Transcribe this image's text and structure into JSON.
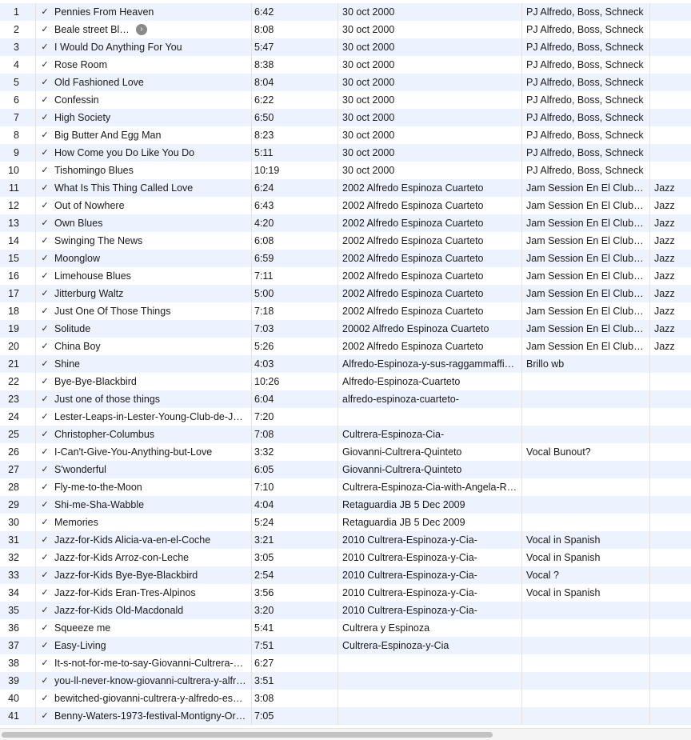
{
  "columns": {
    "check_glyph": "✓",
    "arrow_icon": "chevron-right-circle-icon"
  },
  "tracks": [
    {
      "num": "1",
      "name": "Pennies From Heaven",
      "time": "6:42",
      "album": "30 oct 2000",
      "artist": "PJ Alfredo, Boss, Schneck",
      "genre": ""
    },
    {
      "num": "2",
      "name": "Beale street Blues",
      "time": "8:08",
      "album": "30 oct 2000",
      "artist": "PJ Alfredo, Boss, Schneck",
      "genre": ""
    },
    {
      "num": "3",
      "name": "I Would Do Anything For You",
      "time": "5:47",
      "album": "30 oct 2000",
      "artist": "PJ Alfredo, Boss, Schneck",
      "genre": ""
    },
    {
      "num": "4",
      "name": "Rose Room",
      "time": "8:38",
      "album": "30 oct 2000",
      "artist": "PJ Alfredo, Boss, Schneck",
      "genre": ""
    },
    {
      "num": "5",
      "name": "Old Fashioned Love",
      "time": "8:04",
      "album": "30 oct 2000",
      "artist": "PJ Alfredo, Boss, Schneck",
      "genre": ""
    },
    {
      "num": "6",
      "name": "Confessin",
      "time": "6:22",
      "album": "30 oct 2000",
      "artist": "PJ Alfredo, Boss, Schneck",
      "genre": ""
    },
    {
      "num": "7",
      "name": "High Society",
      "time": "6:50",
      "album": "30 oct 2000",
      "artist": "PJ Alfredo, Boss, Schneck",
      "genre": ""
    },
    {
      "num": "8",
      "name": "Big Butter And Egg Man",
      "time": "8:23",
      "album": "30 oct 2000",
      "artist": "PJ Alfredo, Boss, Schneck",
      "genre": ""
    },
    {
      "num": "9",
      "name": "How Come you Do Like You Do",
      "time": "5:11",
      "album": "30 oct 2000",
      "artist": "PJ Alfredo, Boss, Schneck",
      "genre": ""
    },
    {
      "num": "10",
      "name": "Tishomingo Blues",
      "time": "10:19",
      "album": "30 oct 2000",
      "artist": "PJ Alfredo, Boss, Schneck",
      "genre": ""
    },
    {
      "num": "11",
      "name": "What Is This Thing Called Love",
      "time": "6:24",
      "album": "2002 Alfredo Espinoza Cuarteto",
      "artist": "Jam Session En El Club…",
      "genre": "Jazz"
    },
    {
      "num": "12",
      "name": "Out of Nowhere",
      "time": "6:43",
      "album": "2002 Alfredo Espinoza Cuarteto",
      "artist": "Jam Session En El Club…",
      "genre": "Jazz"
    },
    {
      "num": "13",
      "name": "Own Blues",
      "time": "4:20",
      "album": "2002 Alfredo Espinoza Cuarteto",
      "artist": "Jam Session En El Club…",
      "genre": "Jazz"
    },
    {
      "num": "14",
      "name": "Swinging The News",
      "time": "6:08",
      "album": "2002 Alfredo Espinoza Cuarteto",
      "artist": "Jam Session En El Club…",
      "genre": "Jazz"
    },
    {
      "num": "15",
      "name": "Moonglow",
      "time": "6:59",
      "album": "2002 Alfredo Espinoza Cuarteto",
      "artist": "Jam Session En El Club…",
      "genre": "Jazz"
    },
    {
      "num": "16",
      "name": "Limehouse Blues",
      "time": "7:11",
      "album": "2002 Alfredo Espinoza Cuarteto",
      "artist": "Jam Session En El Club…",
      "genre": "Jazz"
    },
    {
      "num": "17",
      "name": "Jitterburg Waltz",
      "time": "5:00",
      "album": "2002 Alfredo Espinoza Cuarteto",
      "artist": "Jam Session En El Club…",
      "genre": "Jazz"
    },
    {
      "num": "18",
      "name": "Just One Of Those Things",
      "time": "7:18",
      "album": "2002 Alfredo Espinoza Cuarteto",
      "artist": "Jam Session En El Club…",
      "genre": "Jazz"
    },
    {
      "num": "19",
      "name": "Solitude",
      "time": "7:03",
      "album": "20002 Alfredo Espinoza Cuarteto",
      "artist": "Jam Session En El Club…",
      "genre": "Jazz"
    },
    {
      "num": "20",
      "name": "China Boy",
      "time": "5:26",
      "album": "2002 Alfredo Espinoza Cuarteto",
      "artist": "Jam Session En El Club…",
      "genre": "Jazz"
    },
    {
      "num": "21",
      "name": "Shine",
      "time": "4:03",
      "album": "Alfredo-Espinoza-y-sus-raggammaffiel…",
      "artist": "Brillo wb",
      "genre": ""
    },
    {
      "num": "22",
      "name": "Bye-Bye-Blackbird",
      "time": "10:26",
      "album": "Alfredo-Espinoza-Cuarteto",
      "artist": "",
      "genre": ""
    },
    {
      "num": "23",
      "name": "Just one of those things",
      "time": "6:04",
      "album": "alfredo-espinoza-cuarteto-",
      "artist": "",
      "genre": ""
    },
    {
      "num": "24",
      "name": "Lester-Leaps-in-Lester-Young-Club-de-Ja…",
      "time": "7:20",
      "album": "",
      "artist": "",
      "genre": ""
    },
    {
      "num": "25",
      "name": "Christopher-Columbus",
      "time": "7:08",
      "album": "Cultrera-Espinoza-Cia-",
      "artist": "",
      "genre": ""
    },
    {
      "num": "26",
      "name": "I-Can't-Give-You-Anything-but-Love",
      "time": "3:32",
      "album": "Giovanni-Cultrera-Quinteto",
      "artist": "Vocal Bunout?",
      "genre": ""
    },
    {
      "num": "27",
      "name": "S'wonderful",
      "time": "6:05",
      "album": "Giovanni-Cultrera-Quinteto",
      "artist": "",
      "genre": ""
    },
    {
      "num": "28",
      "name": "Fly-me-to-the-Moon",
      "time": "7:10",
      "album": "Cultrera-Espinoza-Cia-with-Angela-Ro…",
      "artist": "",
      "genre": ""
    },
    {
      "num": "29",
      "name": "Shi-me-Sha-Wabble",
      "time": "4:04",
      "album": "Retaguardia JB 5 Dec 2009",
      "artist": "",
      "genre": ""
    },
    {
      "num": "30",
      "name": "Memories",
      "time": "5:24",
      "album": "Retaguardia JB 5 Dec 2009",
      "artist": "",
      "genre": ""
    },
    {
      "num": "31",
      "name": "Jazz-for-Kids Alicia-va-en-el-Coche",
      "time": "3:21",
      "album": "2010 Cultrera-Espinoza-y-Cia-",
      "artist": "Vocal in Spanish",
      "genre": ""
    },
    {
      "num": "32",
      "name": "Jazz-for-Kids Arroz-con-Leche",
      "time": "3:05",
      "album": "2010 Cultrera-Espinoza-y-Cia-",
      "artist": "Vocal in Spanish",
      "genre": ""
    },
    {
      "num": "33",
      "name": "Jazz-for-Kids Bye-Bye-Blackbird",
      "time": "2:54",
      "album": "2010 Cultrera-Espinoza-y-Cia-",
      "artist": "Vocal ?",
      "genre": ""
    },
    {
      "num": "34",
      "name": "Jazz-for-Kids Eran-Tres-Alpinos",
      "time": "3:56",
      "album": "2010 Cultrera-Espinoza-y-Cia-",
      "artist": "Vocal in Spanish",
      "genre": ""
    },
    {
      "num": "35",
      "name": "Jazz-for-Kids Old-Macdonald",
      "time": "3:20",
      "album": "2010 Cultrera-Espinoza-y-Cia-",
      "artist": "",
      "genre": ""
    },
    {
      "num": "36",
      "name": "Squeeze me",
      "time": "5:41",
      "album": "Cultrera y Espinoza",
      "artist": "",
      "genre": ""
    },
    {
      "num": "37",
      "name": "Easy-Living",
      "time": "7:51",
      "album": "Cultrera-Espinoza-y-Cia",
      "artist": "",
      "genre": ""
    },
    {
      "num": "38",
      "name": "It-s-not-for-me-to-say-Giovanni-Cultrera-y…",
      "time": "6:27",
      "album": "",
      "artist": "",
      "genre": ""
    },
    {
      "num": "39",
      "name": "you-ll-never-know-giovanni-cultrera-y-alfr…",
      "time": "3:51",
      "album": "",
      "artist": "",
      "genre": ""
    },
    {
      "num": "40",
      "name": "bewitched-giovanni-cultrera-y-alfredo-esp…",
      "time": "3:08",
      "album": "",
      "artist": "",
      "genre": ""
    },
    {
      "num": "41",
      "name": "Benny-Waters-1973-festival-Montigny-Ori…",
      "time": "7:05",
      "album": "",
      "artist": "",
      "genre": ""
    }
  ]
}
